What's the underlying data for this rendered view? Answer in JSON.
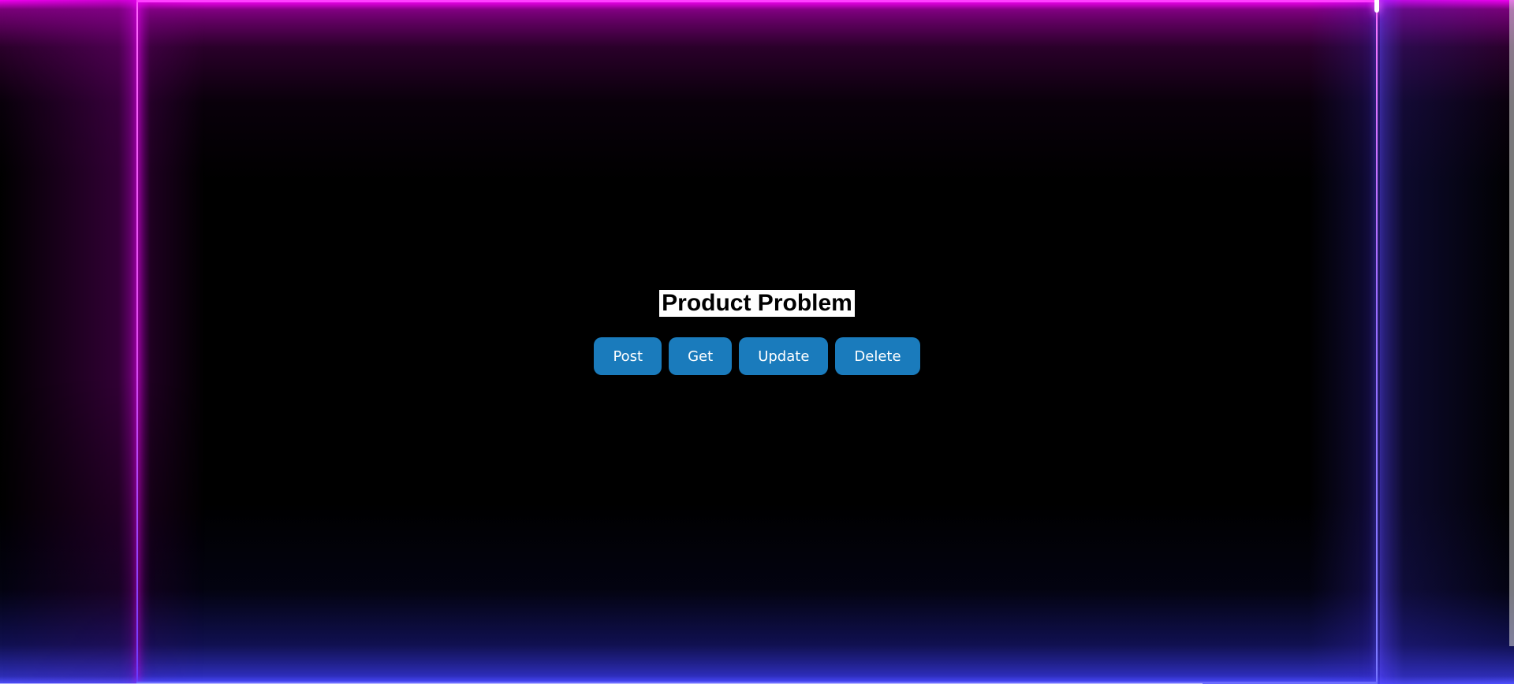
{
  "page": {
    "title": "Product Problem"
  },
  "actions": {
    "post_label": "Post",
    "get_label": "Get",
    "update_label": "Update",
    "delete_label": "Delete"
  },
  "colors": {
    "background": "#000000",
    "top_glow": "#ff00ff",
    "bottom_glow": "#4a4aff",
    "button": "#1a7bbc",
    "button_text": "#ffffff",
    "title_bg": "#ffffff",
    "title_text": "#000000"
  }
}
